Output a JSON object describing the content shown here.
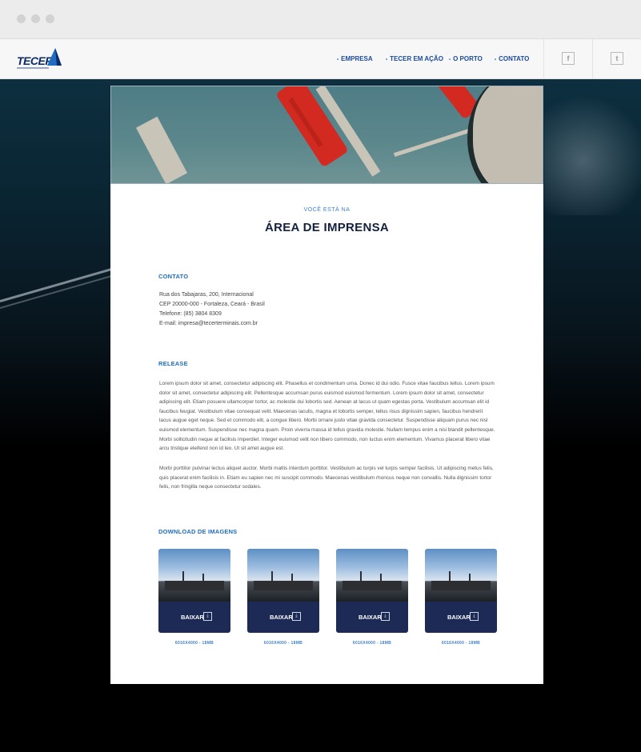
{
  "header": {
    "logo_text": "TECER",
    "nav": [
      {
        "label": "EMPRESA"
      },
      {
        "label": "TECER EM AÇÃO"
      },
      {
        "label": "O PORTO"
      },
      {
        "label": "CONTATO"
      }
    ],
    "social": [
      {
        "icon": "facebook-icon",
        "glyph": "f"
      },
      {
        "icon": "twitter-icon",
        "glyph": "t"
      }
    ]
  },
  "page": {
    "eyebrow": "VOCÊ ESTÁ NA",
    "title": "ÁREA DE IMPRENSA"
  },
  "contact": {
    "title": "CONTATO",
    "lines": [
      "Rua dos Tabajaras, 200, Internacional",
      "CEP 20000-000 - Fortaleza, Ceará - Brasil",
      "Telefone: (85) 3804 8309",
      "E-mail: impresa@tecerterminais.com.br"
    ]
  },
  "release": {
    "title": "RELEASE",
    "paragraphs": [
      "Lorem ipsum dolor sit amet, consectetur adipiscing elit. Phasellus et condimentum urna. Donec id dui odio. Fusce vitae faucibus tellus. Lorem ipsum dolor sit amet, consectetur adipiscing elit. Pellentesque accumsan purus euismod euismod fermentum. Lorem ipsum dolor sit amet, consectetur adipiscing elit. Etiam posuere ullamcorper tortor, ac molestie dui lobortis sed. Aenean at lacus ut quam egestas porta. Vestibulum accumsan elit id faucibus feugiat. Vestibulum vitae consequat velit. Maecenas iaculis, magna et lobortis semper, tellus risus dignissim sapien, faucibus hendrerit lacus augue eget neque. Sed et commodo elit, a congue libero. Morbi ornare justo vitae gravida consectetur. Suspendisse aliquam purus nec nisl euismod elementum. Suspendisse nec magna quam. Proin viverra massa id tellus gravida molestie. Nullam tempus enim a nisi blandit pellentesque. Morbi sollicitudin neque at facilisis imperdiet. Integer euismod velit non libero commodo, non luctus enim elementum. Vivamus placerat libero vitae arcu tristique eleifend non id leo. Ut sit amet augue est.",
      "Morbi porttitor pulvinar lectus aliquet auctor. Morbi mattis interdum porttitor. Vestibulum ac turpis vel turpis semper facilisis. Ut adipiscing metus felis, quis placerat enim facilisis in. Etiam eu sapien nec mi suscipit commodo. Maecenas vestibulum rhoncus neque non convallis. Nulla dignissim tortor felis, non fringilla neque consectetur sodales."
    ]
  },
  "downloads": {
    "title": "DOWNLOAD DE IMAGENS",
    "items": [
      {
        "button": "BAIXAR",
        "size": "6016X4000 - 18MB"
      },
      {
        "button": "BAIXAR",
        "size": "6016X4000 - 18MB"
      },
      {
        "button": "BAIXAR",
        "size": "6016X4000 - 18MB"
      },
      {
        "button": "BAIXAR",
        "size": "6016X4000 - 18MB"
      }
    ]
  },
  "colors": {
    "accent": "#1f6dc0",
    "nav": "#1c4a99",
    "title": "#13213f",
    "button_bg": "#1d2a56"
  }
}
